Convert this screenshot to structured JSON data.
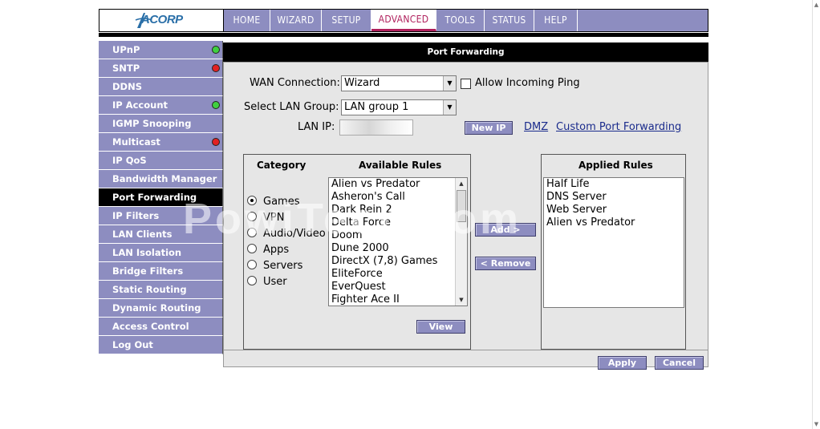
{
  "brand": {
    "logo_text": "ACORP"
  },
  "nav": {
    "items": [
      {
        "label": "HOME"
      },
      {
        "label": "WIZARD"
      },
      {
        "label": "SETUP"
      },
      {
        "label": "ADVANCED"
      },
      {
        "label": "TOOLS"
      },
      {
        "label": "STATUS"
      },
      {
        "label": "HELP"
      }
    ],
    "active": "ADVANCED"
  },
  "sidebar": {
    "items": [
      {
        "label": "UPnP",
        "status": "green"
      },
      {
        "label": "SNTP",
        "status": "red"
      },
      {
        "label": "DDNS"
      },
      {
        "label": "IP Account",
        "status": "green"
      },
      {
        "label": "IGMP Snooping"
      },
      {
        "label": "Multicast",
        "status": "red"
      },
      {
        "label": "IP QoS"
      },
      {
        "label": "Bandwidth Manager"
      },
      {
        "label": "Port Forwarding",
        "active": true
      },
      {
        "label": "IP Filters"
      },
      {
        "label": "LAN Clients"
      },
      {
        "label": "LAN Isolation"
      },
      {
        "label": "Bridge Filters"
      },
      {
        "label": "Static Routing"
      },
      {
        "label": "Dynamic Routing"
      },
      {
        "label": "Access Control"
      },
      {
        "label": "Log Out"
      }
    ]
  },
  "main": {
    "title": "Port Forwarding",
    "wan_label": "WAN Connection:",
    "wan_value": "Wizard",
    "allow_ping_label": "Allow Incoming Ping",
    "lan_group_label": "Select LAN Group:",
    "lan_group_value": "LAN group 1",
    "lan_ip_label": "LAN IP:",
    "new_ip_button": "New IP",
    "dmz_link": "DMZ",
    "custom_pf_link": "Custom Port Forwarding",
    "category_header": "Category",
    "available_header": "Available Rules",
    "applied_header": "Applied Rules",
    "categories": [
      {
        "label": "Games",
        "selected": true
      },
      {
        "label": "VPN"
      },
      {
        "label": "Audio/Video"
      },
      {
        "label": "Apps"
      },
      {
        "label": "Servers"
      },
      {
        "label": "User"
      }
    ],
    "available_rules": [
      "Alien vs Predator",
      "Asheron's Call",
      "Dark Rein 2",
      "Delta Force",
      "Doom",
      "Dune 2000",
      "DirectX (7,8) Games",
      "EliteForce",
      "EverQuest",
      "Fighter Ace II"
    ],
    "applied_rules": [
      "Half Life",
      "DNS Server",
      "Web Server",
      "Alien vs Predator"
    ],
    "add_button": "Add >",
    "remove_button": "< Remove",
    "view_button": "View",
    "apply_button": "Apply",
    "cancel_button": "Cancel"
  },
  "watermark": "PowiTech.com",
  "colors": {
    "nav_bg": "#8d8dc0",
    "active_tab_text": "#b0205c",
    "panel_bg": "#e6e6e6",
    "link": "#1a2b8c"
  }
}
